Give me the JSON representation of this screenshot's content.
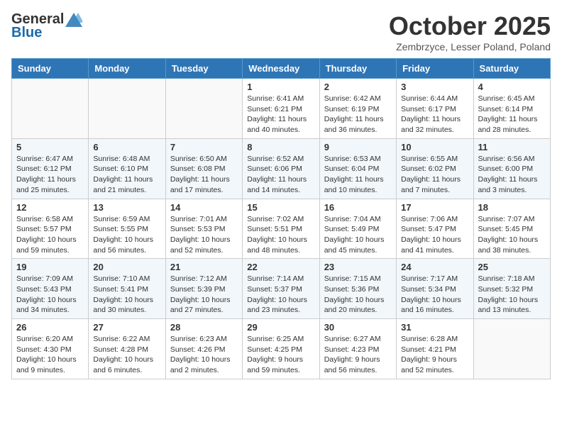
{
  "header": {
    "logo_general": "General",
    "logo_blue": "Blue",
    "month": "October 2025",
    "location": "Zembrzyce, Lesser Poland, Poland"
  },
  "days_of_week": [
    "Sunday",
    "Monday",
    "Tuesday",
    "Wednesday",
    "Thursday",
    "Friday",
    "Saturday"
  ],
  "weeks": [
    [
      {
        "day": "",
        "info": ""
      },
      {
        "day": "",
        "info": ""
      },
      {
        "day": "",
        "info": ""
      },
      {
        "day": "1",
        "info": "Sunrise: 6:41 AM\nSunset: 6:21 PM\nDaylight: 11 hours\nand 40 minutes."
      },
      {
        "day": "2",
        "info": "Sunrise: 6:42 AM\nSunset: 6:19 PM\nDaylight: 11 hours\nand 36 minutes."
      },
      {
        "day": "3",
        "info": "Sunrise: 6:44 AM\nSunset: 6:17 PM\nDaylight: 11 hours\nand 32 minutes."
      },
      {
        "day": "4",
        "info": "Sunrise: 6:45 AM\nSunset: 6:14 PM\nDaylight: 11 hours\nand 28 minutes."
      }
    ],
    [
      {
        "day": "5",
        "info": "Sunrise: 6:47 AM\nSunset: 6:12 PM\nDaylight: 11 hours\nand 25 minutes."
      },
      {
        "day": "6",
        "info": "Sunrise: 6:48 AM\nSunset: 6:10 PM\nDaylight: 11 hours\nand 21 minutes."
      },
      {
        "day": "7",
        "info": "Sunrise: 6:50 AM\nSunset: 6:08 PM\nDaylight: 11 hours\nand 17 minutes."
      },
      {
        "day": "8",
        "info": "Sunrise: 6:52 AM\nSunset: 6:06 PM\nDaylight: 11 hours\nand 14 minutes."
      },
      {
        "day": "9",
        "info": "Sunrise: 6:53 AM\nSunset: 6:04 PM\nDaylight: 11 hours\nand 10 minutes."
      },
      {
        "day": "10",
        "info": "Sunrise: 6:55 AM\nSunset: 6:02 PM\nDaylight: 11 hours\nand 7 minutes."
      },
      {
        "day": "11",
        "info": "Sunrise: 6:56 AM\nSunset: 6:00 PM\nDaylight: 11 hours\nand 3 minutes."
      }
    ],
    [
      {
        "day": "12",
        "info": "Sunrise: 6:58 AM\nSunset: 5:57 PM\nDaylight: 10 hours\nand 59 minutes."
      },
      {
        "day": "13",
        "info": "Sunrise: 6:59 AM\nSunset: 5:55 PM\nDaylight: 10 hours\nand 56 minutes."
      },
      {
        "day": "14",
        "info": "Sunrise: 7:01 AM\nSunset: 5:53 PM\nDaylight: 10 hours\nand 52 minutes."
      },
      {
        "day": "15",
        "info": "Sunrise: 7:02 AM\nSunset: 5:51 PM\nDaylight: 10 hours\nand 48 minutes."
      },
      {
        "day": "16",
        "info": "Sunrise: 7:04 AM\nSunset: 5:49 PM\nDaylight: 10 hours\nand 45 minutes."
      },
      {
        "day": "17",
        "info": "Sunrise: 7:06 AM\nSunset: 5:47 PM\nDaylight: 10 hours\nand 41 minutes."
      },
      {
        "day": "18",
        "info": "Sunrise: 7:07 AM\nSunset: 5:45 PM\nDaylight: 10 hours\nand 38 minutes."
      }
    ],
    [
      {
        "day": "19",
        "info": "Sunrise: 7:09 AM\nSunset: 5:43 PM\nDaylight: 10 hours\nand 34 minutes."
      },
      {
        "day": "20",
        "info": "Sunrise: 7:10 AM\nSunset: 5:41 PM\nDaylight: 10 hours\nand 30 minutes."
      },
      {
        "day": "21",
        "info": "Sunrise: 7:12 AM\nSunset: 5:39 PM\nDaylight: 10 hours\nand 27 minutes."
      },
      {
        "day": "22",
        "info": "Sunrise: 7:14 AM\nSunset: 5:37 PM\nDaylight: 10 hours\nand 23 minutes."
      },
      {
        "day": "23",
        "info": "Sunrise: 7:15 AM\nSunset: 5:36 PM\nDaylight: 10 hours\nand 20 minutes."
      },
      {
        "day": "24",
        "info": "Sunrise: 7:17 AM\nSunset: 5:34 PM\nDaylight: 10 hours\nand 16 minutes."
      },
      {
        "day": "25",
        "info": "Sunrise: 7:18 AM\nSunset: 5:32 PM\nDaylight: 10 hours\nand 13 minutes."
      }
    ],
    [
      {
        "day": "26",
        "info": "Sunrise: 6:20 AM\nSunset: 4:30 PM\nDaylight: 10 hours\nand 9 minutes."
      },
      {
        "day": "27",
        "info": "Sunrise: 6:22 AM\nSunset: 4:28 PM\nDaylight: 10 hours\nand 6 minutes."
      },
      {
        "day": "28",
        "info": "Sunrise: 6:23 AM\nSunset: 4:26 PM\nDaylight: 10 hours\nand 2 minutes."
      },
      {
        "day": "29",
        "info": "Sunrise: 6:25 AM\nSunset: 4:25 PM\nDaylight: 9 hours\nand 59 minutes."
      },
      {
        "day": "30",
        "info": "Sunrise: 6:27 AM\nSunset: 4:23 PM\nDaylight: 9 hours\nand 56 minutes."
      },
      {
        "day": "31",
        "info": "Sunrise: 6:28 AM\nSunset: 4:21 PM\nDaylight: 9 hours\nand 52 minutes."
      },
      {
        "day": "",
        "info": ""
      }
    ]
  ]
}
